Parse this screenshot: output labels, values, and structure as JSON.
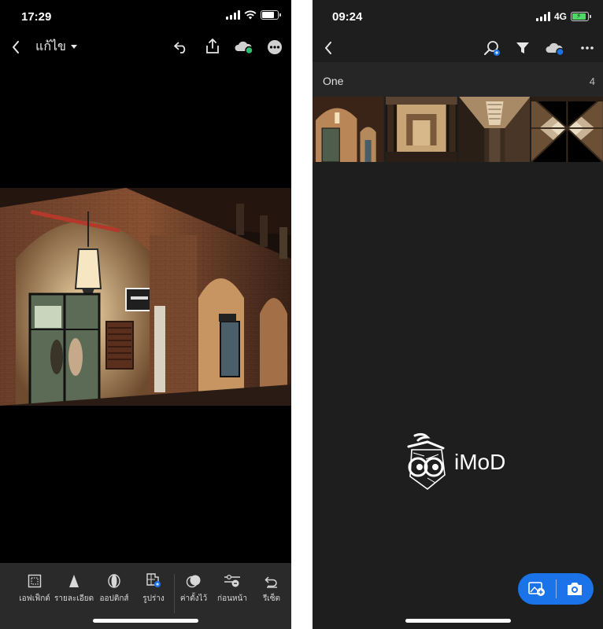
{
  "left_phone": {
    "status": {
      "time": "17:29"
    },
    "toolbar": {
      "title": "แก้ไข"
    },
    "tools": [
      {
        "label": "เอฟเฟ็กต์",
        "icon": "effects-icon"
      },
      {
        "label": "รายละเอียด",
        "icon": "detail-icon"
      },
      {
        "label": "ออปติกส์",
        "icon": "optics-icon"
      },
      {
        "label": "รูปร่าง",
        "icon": "geometry-icon"
      },
      {
        "label": "ค่าตั้งไว้",
        "icon": "presets-icon"
      },
      {
        "label": "ก่อนหน้า",
        "icon": "previous-icon"
      },
      {
        "label": "รีเซ็ต",
        "icon": "reset-icon"
      }
    ]
  },
  "right_phone": {
    "status": {
      "time": "09:24",
      "network": "4G"
    },
    "album": {
      "name": "One",
      "count": "4"
    },
    "watermark": {
      "text": "iMoD"
    }
  },
  "colors": {
    "accent_blue": "#1a73e8",
    "cloud_sync_green": "#2fbf71",
    "cloud_sync_blue": "#1a73e8",
    "battery_charge": "#4cd964"
  }
}
